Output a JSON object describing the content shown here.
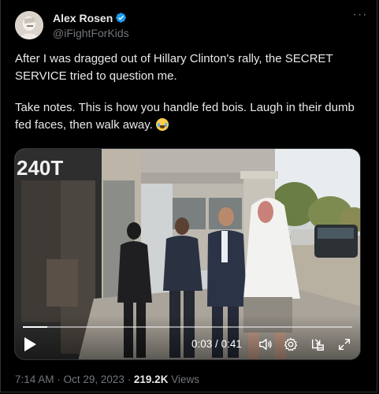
{
  "author": {
    "name": "Alex Rosen",
    "handle": "@iFightForKids",
    "verified": true
  },
  "tweet": {
    "paragraph1": "After I was dragged out of Hillary Clinton's rally, the SECRET SERVICE tried to question me.",
    "paragraph2": "Take notes. This is how you handle fed bois. Laugh in their dumb fed faces, then walk away.",
    "emoji": "face-with-tears-of-joy"
  },
  "media": {
    "type": "video",
    "storefront_text": "240T",
    "current_time": "0:03",
    "separator": "/",
    "duration": "0:41",
    "progress": 0.073
  },
  "footer": {
    "time": "7:14 AM",
    "dot1": "·",
    "date": "Oct 29, 2023",
    "dot2": "·",
    "views_count": "219.2K",
    "views_label": "Views"
  },
  "colors": {
    "background": "#000000",
    "text": "#e7e9ea",
    "muted": "#71767b",
    "verified": "#1d9bf0",
    "border": "#2f3336"
  }
}
